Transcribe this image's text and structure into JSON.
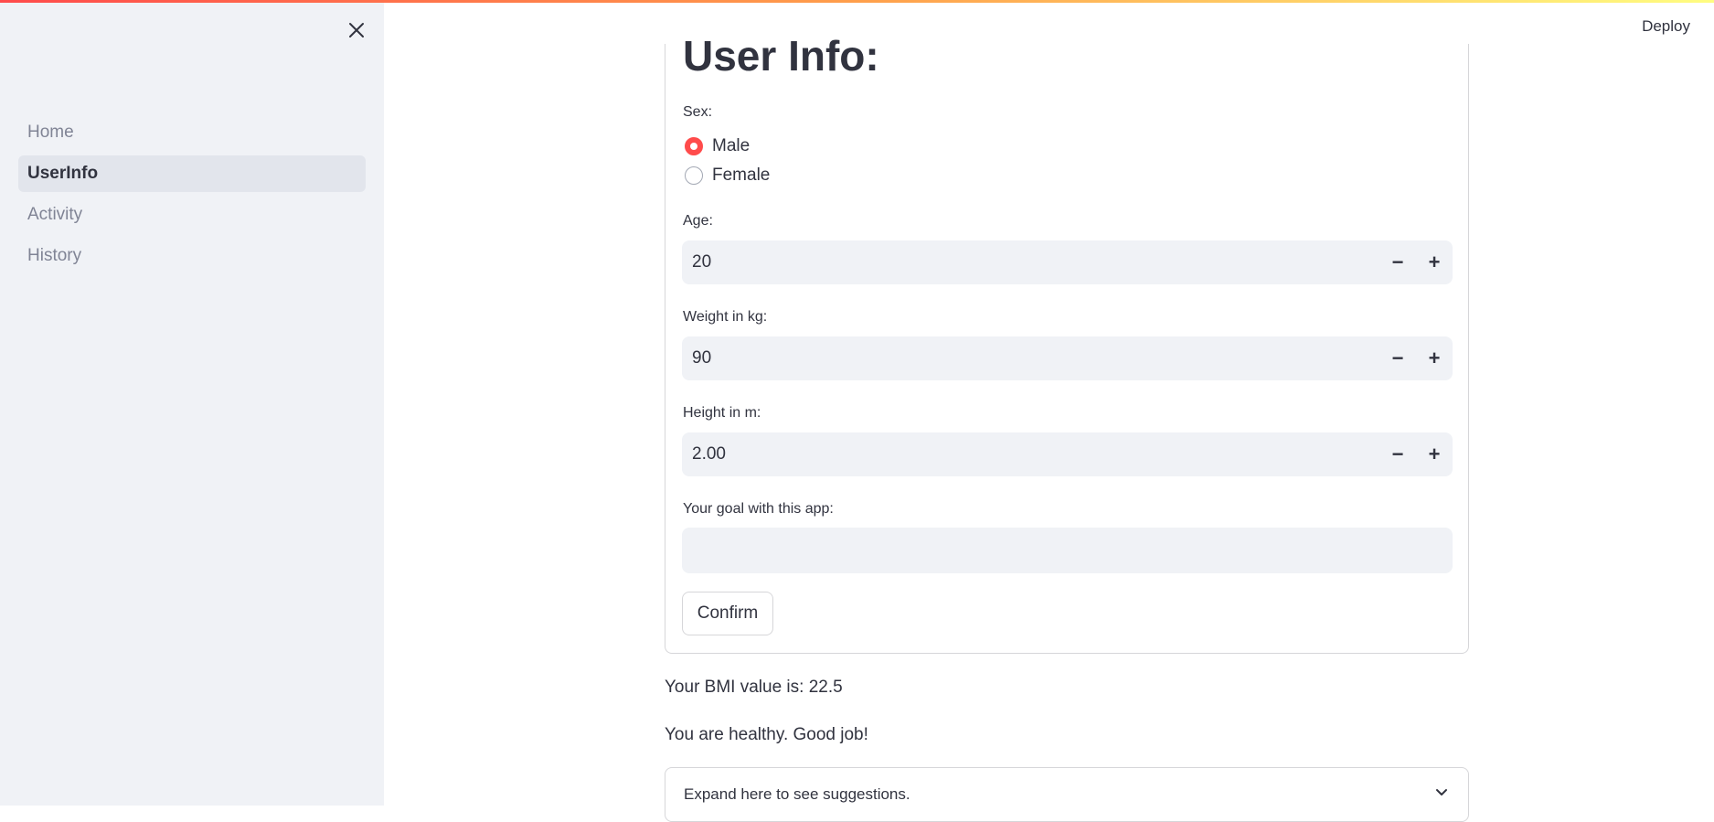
{
  "header": {
    "deploy_label": "Deploy"
  },
  "sidebar": {
    "items": [
      {
        "label": "Home"
      },
      {
        "label": "UserInfo"
      },
      {
        "label": "Activity"
      },
      {
        "label": "History"
      }
    ],
    "active_item": "UserInfo",
    "close_icon": "close-icon"
  },
  "form": {
    "title": "User Info:",
    "sex": {
      "label": "Sex:",
      "options": [
        "Male",
        "Female"
      ],
      "selected": "Male"
    },
    "age": {
      "label": "Age:",
      "value": "20"
    },
    "weight": {
      "label": "Weight in kg:",
      "value": "90"
    },
    "height": {
      "label": "Height in m:",
      "value": "2.00"
    },
    "goal": {
      "label": "Your goal with this app:",
      "value": ""
    },
    "confirm_label": "Confirm",
    "minus_symbol": "−",
    "plus_symbol": "+"
  },
  "results": {
    "bmi_text": "Your BMI value is: 22.5",
    "status_text": "You are healthy. Good job!"
  },
  "expander": {
    "label": "Expand here to see suggestions.",
    "icon": "chevron-down-icon"
  },
  "colors": {
    "accent": "#ff4b4b",
    "sidebar_bg": "#f0f2f6",
    "text": "#31333f",
    "muted": "#808495"
  }
}
